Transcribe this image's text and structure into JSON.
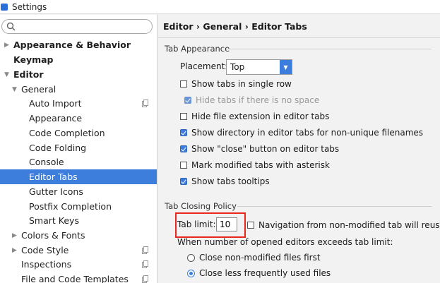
{
  "window": {
    "title": "Settings"
  },
  "search": {
    "placeholder": ""
  },
  "sidebar": {
    "items": [
      {
        "label": "Appearance & Behavior"
      },
      {
        "label": "Keymap"
      },
      {
        "label": "Editor"
      },
      {
        "label": "General"
      },
      {
        "label": "Auto Import"
      },
      {
        "label": "Appearance"
      },
      {
        "label": "Code Completion"
      },
      {
        "label": "Code Folding"
      },
      {
        "label": "Console"
      },
      {
        "label": "Editor Tabs"
      },
      {
        "label": "Gutter Icons"
      },
      {
        "label": "Postfix Completion"
      },
      {
        "label": "Smart Keys"
      },
      {
        "label": "Colors & Fonts"
      },
      {
        "label": "Code Style"
      },
      {
        "label": "Inspections"
      },
      {
        "label": "File and Code Templates"
      }
    ]
  },
  "breadcrumb": "Editor › General › Editor Tabs",
  "tab_appearance": {
    "title": "Tab Appearance",
    "placement_label": "Placement:",
    "placement_value": "Top",
    "options": [
      {
        "label": "Show tabs in single row",
        "checked": false
      },
      {
        "label": "Hide tabs if there is no space",
        "checked": true,
        "disabled": true
      },
      {
        "label": "Hide file extension in editor tabs",
        "checked": false
      },
      {
        "label": "Show directory in editor tabs for non-unique filenames",
        "checked": true
      },
      {
        "label": "Show \"close\" button on editor tabs",
        "checked": true
      },
      {
        "label": "Mark modified tabs with asterisk",
        "checked": false
      },
      {
        "label": "Show tabs tooltips",
        "checked": true
      }
    ]
  },
  "tab_closing": {
    "title": "Tab Closing Policy",
    "limit_label": "Tab limit:",
    "limit_value": "10",
    "navigation_label": "Navigation from non-modified tab will reuse it",
    "exceeds_label": "When number of opened editors exceeds tab limit:",
    "close_non_modified": "Close non-modified files first",
    "close_less_frequent": "Close less frequently used files"
  },
  "colors": {
    "accent": "#3d7edc",
    "highlight": "#e8281d"
  }
}
